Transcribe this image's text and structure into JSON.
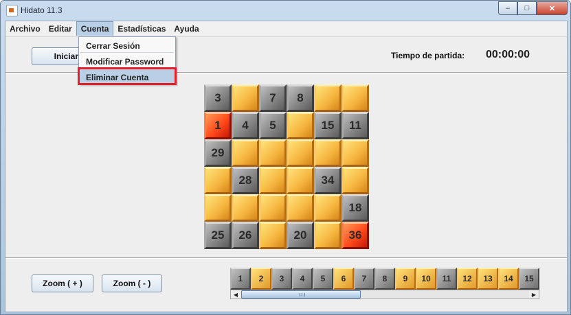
{
  "window": {
    "title": "Hidato 11.3",
    "controls": {
      "minimize": "–",
      "maximize": "□",
      "close": "✕"
    }
  },
  "menubar": {
    "items": [
      "Archivo",
      "Editar",
      "Cuenta",
      "Estadísticas",
      "Ayuda"
    ],
    "open_index": 2
  },
  "cuenta_menu": {
    "items": [
      "Cerrar Sesión",
      "Modificar Password",
      "Eliminar Cuenta"
    ],
    "selected": "Eliminar Cuenta"
  },
  "toolbar": {
    "start_button_label": "Iniciar partida",
    "time_label": "Tiempo de partida:",
    "time_value": "00:00:00"
  },
  "board": {
    "rows": [
      [
        {
          "v": "3",
          "c": "g"
        },
        {
          "v": "",
          "c": "o"
        },
        {
          "v": "7",
          "c": "g"
        },
        {
          "v": "8",
          "c": "g"
        },
        {
          "v": "",
          "c": "o"
        },
        {
          "v": "",
          "c": "o"
        }
      ],
      [
        {
          "v": "1",
          "c": "r"
        },
        {
          "v": "4",
          "c": "g"
        },
        {
          "v": "5",
          "c": "g"
        },
        {
          "v": "",
          "c": "o"
        },
        {
          "v": "15",
          "c": "g"
        },
        {
          "v": "11",
          "c": "g"
        }
      ],
      [
        {
          "v": "29",
          "c": "g"
        },
        {
          "v": "",
          "c": "o"
        },
        {
          "v": "",
          "c": "o"
        },
        {
          "v": "",
          "c": "o"
        },
        {
          "v": "",
          "c": "o"
        },
        {
          "v": "",
          "c": "o"
        }
      ],
      [
        {
          "v": "",
          "c": "o"
        },
        {
          "v": "28",
          "c": "g"
        },
        {
          "v": "",
          "c": "o"
        },
        {
          "v": "",
          "c": "o"
        },
        {
          "v": "34",
          "c": "g"
        },
        {
          "v": "",
          "c": "o"
        }
      ],
      [
        {
          "v": "",
          "c": "o"
        },
        {
          "v": "",
          "c": "o"
        },
        {
          "v": "",
          "c": "o"
        },
        {
          "v": "",
          "c": "o"
        },
        {
          "v": "",
          "c": "o"
        },
        {
          "v": "18",
          "c": "g"
        }
      ],
      [
        {
          "v": "25",
          "c": "g"
        },
        {
          "v": "26",
          "c": "g"
        },
        {
          "v": "",
          "c": "o"
        },
        {
          "v": "20",
          "c": "g"
        },
        {
          "v": "",
          "c": "o"
        },
        {
          "v": "36",
          "c": "r"
        }
      ]
    ]
  },
  "zoom": {
    "in_label": "Zoom ( + )",
    "out_label": "Zoom ( - )"
  },
  "number_strip": {
    "cells": [
      {
        "v": "1",
        "c": "g"
      },
      {
        "v": "2",
        "c": "o"
      },
      {
        "v": "3",
        "c": "g"
      },
      {
        "v": "4",
        "c": "g"
      },
      {
        "v": "5",
        "c": "g"
      },
      {
        "v": "6",
        "c": "o"
      },
      {
        "v": "7",
        "c": "g"
      },
      {
        "v": "8",
        "c": "g"
      },
      {
        "v": "9",
        "c": "o"
      },
      {
        "v": "10",
        "c": "o"
      },
      {
        "v": "11",
        "c": "g"
      },
      {
        "v": "12",
        "c": "o"
      },
      {
        "v": "13",
        "c": "o"
      },
      {
        "v": "14",
        "c": "o"
      },
      {
        "v": "15",
        "c": "g"
      }
    ]
  },
  "colors": {
    "given": "#8c8c8c",
    "empty": "#f7b842",
    "endpoint": "#ff4a1a",
    "highlight": "#e0202a"
  }
}
